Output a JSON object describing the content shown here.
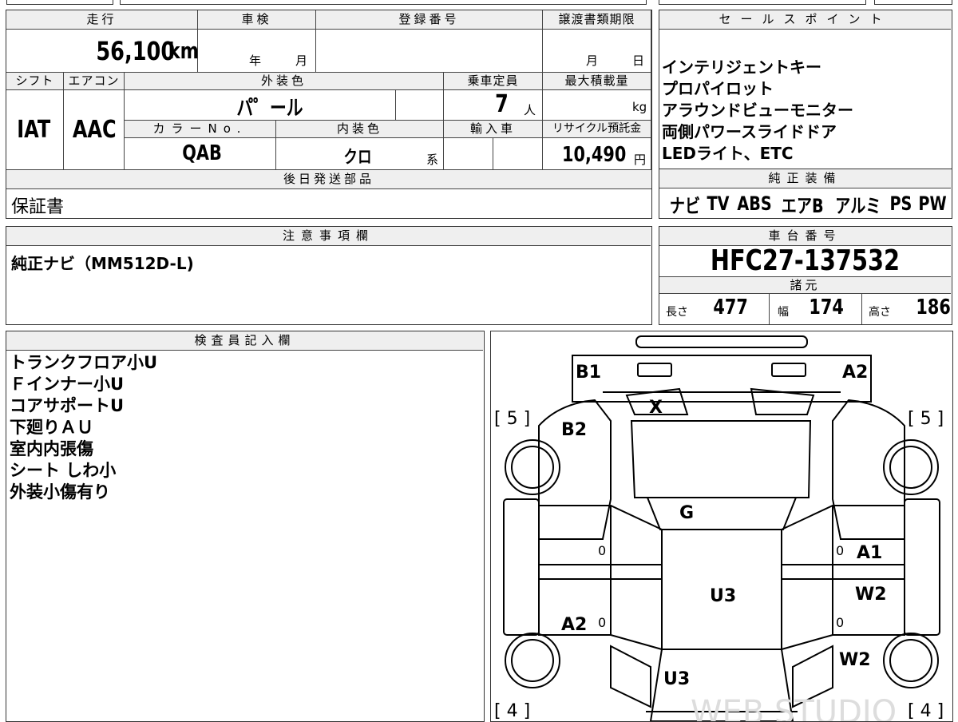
{
  "vehicle": {
    "mileage_label": "走行",
    "mileage": "56,100",
    "mileage_unit": "km",
    "inspection_label": "車検",
    "inspection_year_unit": "年",
    "inspection_month_unit": "月",
    "registration_label": "登録番号",
    "transfer_deadline_label": "譲渡書類期限",
    "transfer_month_unit": "月",
    "transfer_day_unit": "日",
    "shift_label": "シフト",
    "shift": "IAT",
    "ac_label": "エアコン",
    "ac": "AAC",
    "exterior_color_label": "外装色",
    "exterior_color": "パ゜ール",
    "capacity_label": "乗車定員",
    "capacity": "7",
    "capacity_unit": "人",
    "max_load_label": "最大積載量",
    "max_load_unit": "kg",
    "color_no_label": "カラーNo.",
    "color_no": "QAB",
    "interior_color_label": "内装色",
    "interior_color": "クロ",
    "interior_color_suffix": "系",
    "import_label": "輸入車",
    "recycle_label": "リサイクル預託金",
    "recycle_fee": "10,490",
    "recycle_unit": "円"
  },
  "later_parts": {
    "label": "後日発送部品",
    "value": "保証書"
  },
  "notes": {
    "label": "注意事項欄",
    "value": "純正ナビ（MM512D-L)"
  },
  "sales_points": {
    "label": "セールスポイント",
    "items": [
      "インテリジェントキー",
      "プロパイロット",
      "アラウンドビューモニター",
      "両側パワースライドドア",
      "LEDライト、ETC"
    ]
  },
  "equipment": {
    "label": "純正装備",
    "items": [
      "ナビ",
      "TV",
      "ABS",
      "エアB",
      "アルミ",
      "PS",
      "PW"
    ]
  },
  "chassis": {
    "label": "車台番号",
    "value": "HFC27-137532"
  },
  "specs": {
    "label": "諸元",
    "length_label": "長さ",
    "length": "477",
    "width_label": "幅",
    "width": "174",
    "height_label": "高さ",
    "height": "186"
  },
  "inspector": {
    "label": "検査員記入欄",
    "lines": [
      "トランクフロア小U",
      "Ｆインナー小U",
      "コアサポートU",
      "下廻りＡＵ",
      "室内内張傷",
      "シート しわ小",
      "外装小傷有り"
    ]
  },
  "diagram": {
    "marks": [
      "B1",
      "A2",
      "X",
      "B2",
      "G",
      "A1",
      "W2",
      "U3",
      "A2",
      "W2",
      "U3"
    ],
    "tires": [
      "5",
      "5",
      "4",
      "4"
    ],
    "zeros": [
      "0",
      "0",
      "0",
      "0"
    ],
    "watermark": "WEB STUDIO"
  }
}
